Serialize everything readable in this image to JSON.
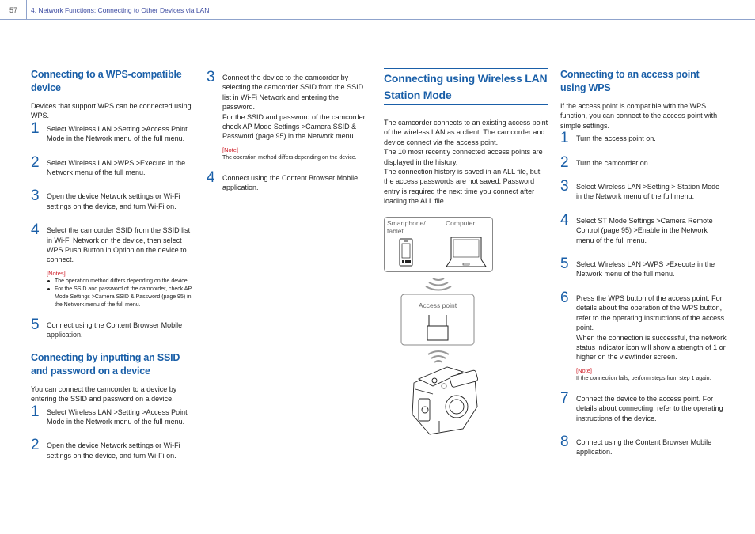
{
  "header": {
    "page_number": "57",
    "chapter_title": "4. Network Functions: Connecting to Other Devices via LAN"
  },
  "col1": {
    "sec1": {
      "title": "Connecting to a WPS-compatible device",
      "intro": "Devices that support WPS can be connected using WPS.",
      "steps": [
        {
          "num": "1",
          "text": "Select Wireless LAN >Setting >Access Point Mode in the Network menu of the full menu."
        },
        {
          "num": "2",
          "text": "Select Wireless LAN >WPS >Execute in the Network menu of the full menu."
        },
        {
          "num": "3",
          "text": "Open the device Network settings or Wi-Fi settings on the device, and turn Wi-Fi on."
        },
        {
          "num": "4",
          "text": "Select the camcorder SSID from the SSID list in Wi-Fi Network on the device, then select WPS Push Button in Option on the device to connect."
        },
        {
          "num": "5",
          "text": "Connect using the Content Browser Mobile application."
        }
      ],
      "notes_label": "[Notes]",
      "notes": [
        "The operation method differs depending on the device.",
        "For the SSID and password of the camcorder, check AP Mode Settings >Camera SSID & Password (page 95) in the Network menu of the full menu."
      ]
    },
    "sec2": {
      "title": "Connecting by inputting an SSID and password on a device",
      "intro": "You can connect the camcorder to a device by entering the SSID and password on a device.",
      "steps": [
        {
          "num": "1",
          "text": "Select Wireless LAN >Setting >Access Point Mode in the Network menu of the full menu."
        },
        {
          "num": "2",
          "text": "Open the device Network settings or Wi-Fi settings on the device, and turn Wi-Fi on."
        }
      ]
    }
  },
  "col2": {
    "steps": [
      {
        "num": "3",
        "text": "Connect the device to the camcorder by selecting the camcorder SSID from the SSID list in Wi-Fi Network and entering the password.\nFor the SSID and password of the camcorder, check AP Mode Settings >Camera SSID & Password (page 95) in the Network menu."
      },
      {
        "num": "4",
        "text": "Connect using the Content Browser Mobile application."
      }
    ],
    "note_label": "[Note]",
    "note_text": "The operation method differs depending on the device."
  },
  "col3": {
    "title": "Connecting using Wireless LAN Station Mode",
    "body": "The camcorder connects to an existing access point of the wireless LAN as a client. The camcorder and device connect via the access point.\nThe 10 most recently connected access points are displayed in the history.\nThe connection history is saved in an ALL file, but the access passwords are not saved. Password entry is required the next time you connect after loading the ALL file.",
    "diagram": {
      "smartphone_label": "Smartphone/ tablet",
      "computer_label": "Computer",
      "access_point_label": "Access point"
    }
  },
  "col4": {
    "title": "Connecting to an access point using WPS",
    "intro": "If the access point is compatible with the WPS function, you can connect to the access point with simple settings.",
    "steps": [
      {
        "num": "1",
        "text": "Turn the access point on."
      },
      {
        "num": "2",
        "text": "Turn the camcorder on."
      },
      {
        "num": "3",
        "text": "Select Wireless LAN >Setting > Station Mode in the Network menu of the full menu."
      },
      {
        "num": "4",
        "text": "Select ST Mode Settings >Camera Remote Control (page 95) >Enable in the Network menu of the full menu."
      },
      {
        "num": "5",
        "text": "Select Wireless LAN >WPS >Execute in the Network menu of the full menu."
      },
      {
        "num": "6",
        "text": "Press the WPS button of the access point. For details about the operation of the WPS button, refer to the operating instructions of the access point.\nWhen the connection is successful, the network status indicator icon will show a strength of 1 or higher on the viewfinder screen."
      },
      {
        "num": "7",
        "text": "Connect the device to the access point. For details about connecting, refer to the operating instructions of the device."
      },
      {
        "num": "8",
        "text": "Connect using the Content Browser Mobile application."
      }
    ],
    "note_label": "[Note]",
    "note_text": "If the connection fails, perform steps from step 1 again."
  }
}
